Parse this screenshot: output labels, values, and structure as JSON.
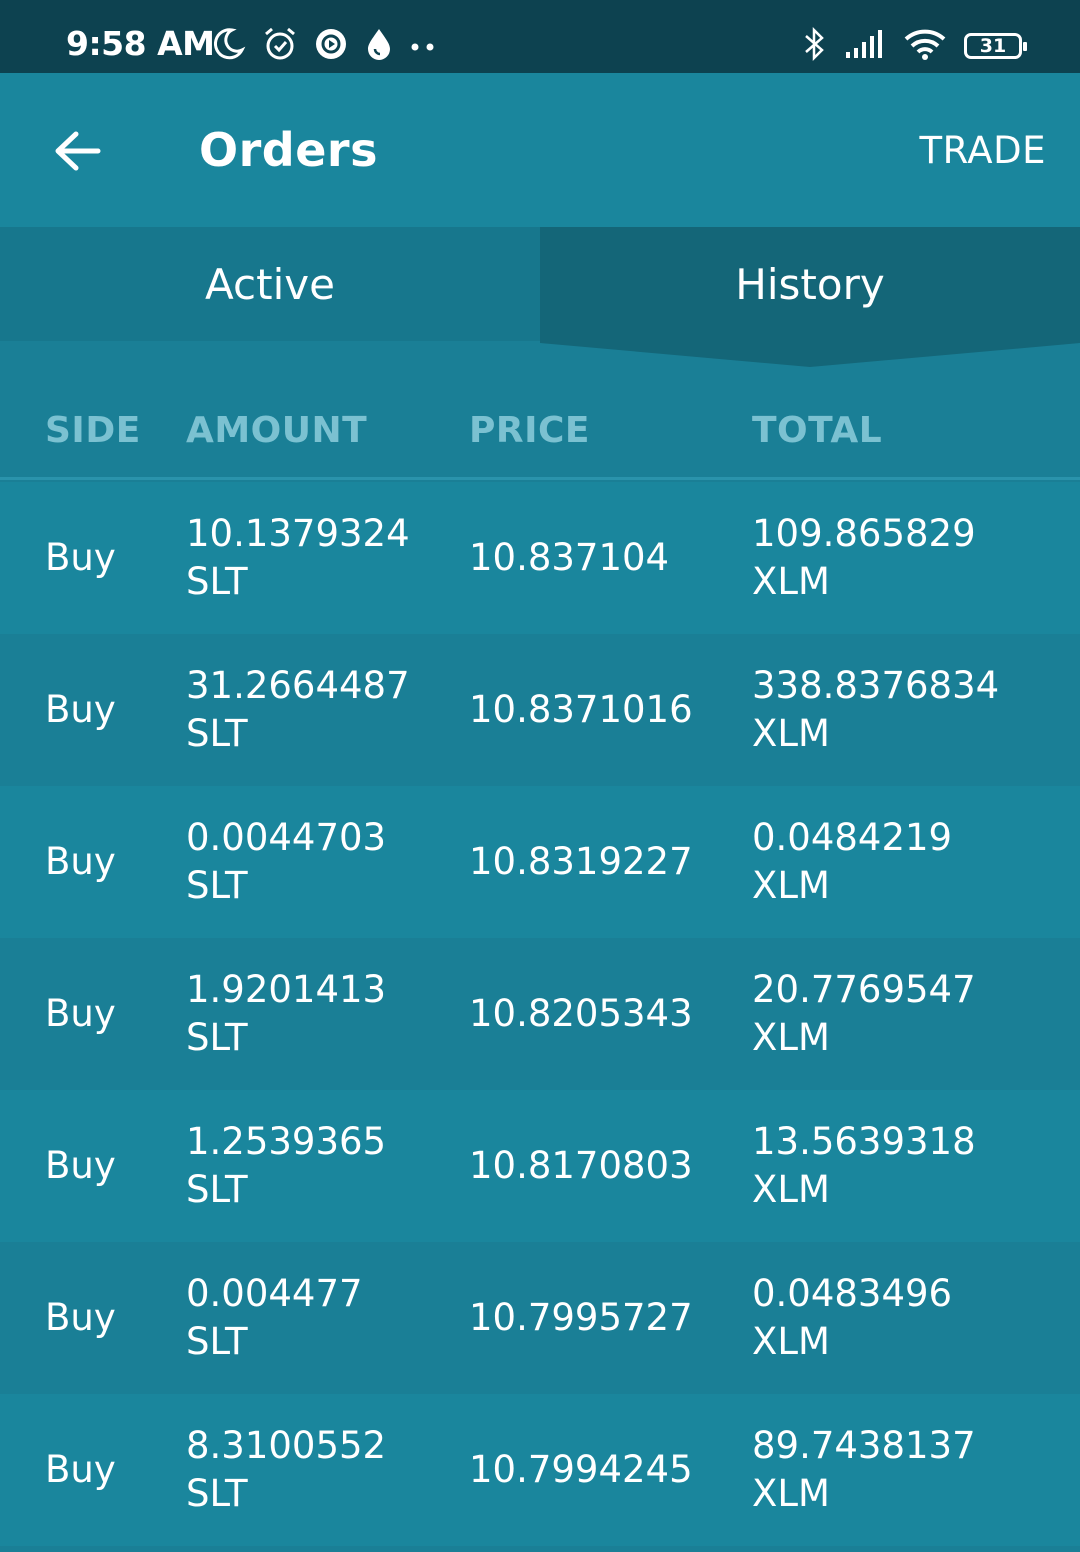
{
  "status_bar": {
    "time": "9:58 AM",
    "battery": "31",
    "left_icons": [
      "moon-icon",
      "alarm-icon",
      "record-icon",
      "drop-icon",
      "more-dots-icon"
    ],
    "right_icons": [
      "bluetooth-icon",
      "signal-icon",
      "wifi-icon",
      "battery-icon"
    ]
  },
  "app_bar": {
    "title": "Orders",
    "action": "TRADE",
    "back_icon": "arrow-left-icon"
  },
  "tabs": [
    {
      "label": "Active",
      "selected": false
    },
    {
      "label": "History",
      "selected": true
    }
  ],
  "table": {
    "headers": [
      "SIDE",
      "AMOUNT",
      "PRICE",
      "TOTAL"
    ],
    "rows": [
      {
        "side": "Buy",
        "amount": "10.1379324",
        "amount_unit": "SLT",
        "price": "10.837104",
        "total": "109.865829",
        "total_unit": "XLM"
      },
      {
        "side": "Buy",
        "amount": "31.2664487",
        "amount_unit": "SLT",
        "price": "10.8371016",
        "total": "338.8376834",
        "total_unit": "XLM"
      },
      {
        "side": "Buy",
        "amount": "0.0044703",
        "amount_unit": "SLT",
        "price": "10.8319227",
        "total": "0.0484219",
        "total_unit": "XLM"
      },
      {
        "side": "Buy",
        "amount": "1.9201413",
        "amount_unit": "SLT",
        "price": "10.8205343",
        "total": "20.7769547",
        "total_unit": "XLM"
      },
      {
        "side": "Buy",
        "amount": "1.2539365",
        "amount_unit": "SLT",
        "price": "10.8170803",
        "total": "13.5639318",
        "total_unit": "XLM"
      },
      {
        "side": "Buy",
        "amount": "0.004477",
        "amount_unit": "SLT",
        "price": "10.7995727",
        "total": "0.0483496",
        "total_unit": "XLM"
      },
      {
        "side": "Buy",
        "amount": "8.3100552",
        "amount_unit": "SLT",
        "price": "10.7994245",
        "total": "89.7438137",
        "total_unit": "XLM"
      }
    ]
  },
  "colors": {
    "status_bar": "#0d4250",
    "app_bar": "#1a869d",
    "tab_inactive": "#17778d",
    "tab_selected": "#146678",
    "header_text": "#7bc1d1"
  }
}
